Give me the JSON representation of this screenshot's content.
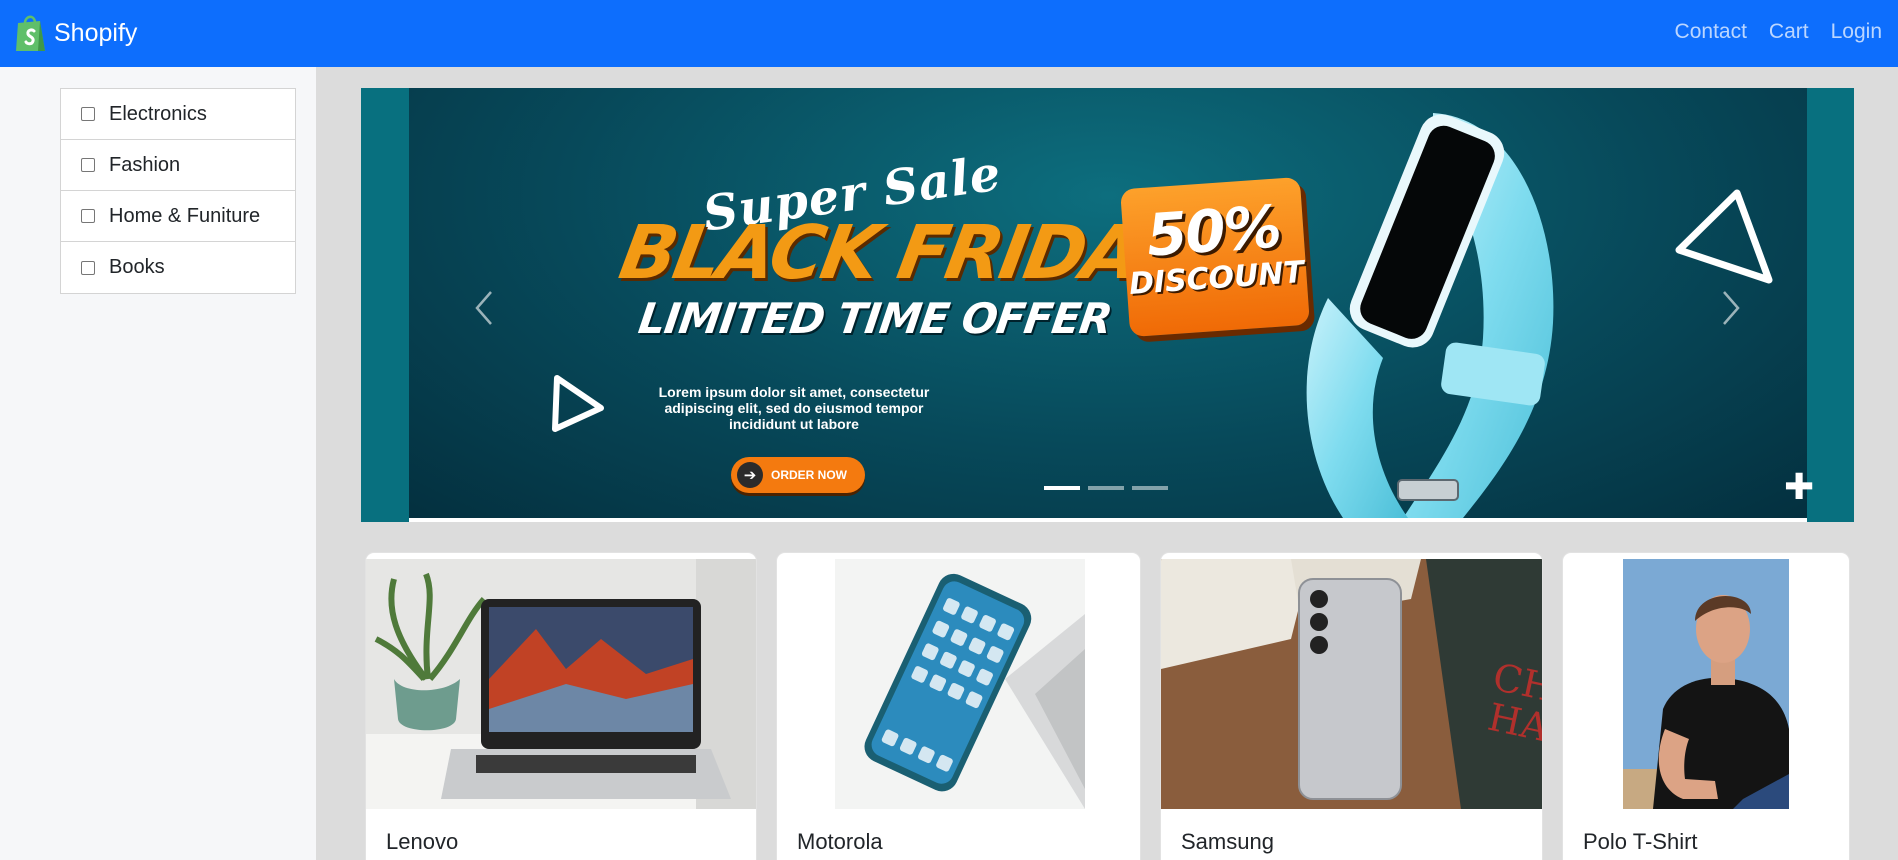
{
  "navbar": {
    "brand": "Shopify",
    "links": [
      "Contact",
      "Cart",
      "Login"
    ],
    "background_color": "#0d6efd",
    "logo_icon": "shopify-bag-icon",
    "logo_color": "#5fbf6a"
  },
  "sidebar": {
    "categories": [
      {
        "label": "Electronics",
        "checked": false
      },
      {
        "label": "Fashion",
        "checked": false
      },
      {
        "label": "Home & Funiture",
        "checked": false
      },
      {
        "label": "Books",
        "checked": false
      }
    ]
  },
  "carousel": {
    "slide_count": 3,
    "active_index": 0,
    "prev_icon": "chevron-left-icon",
    "next_icon": "chevron-right-icon",
    "banner": {
      "script_heading": "Super Sale",
      "heading": "BLACK FRIDAY",
      "subheading": "LIMITED TIME OFFER",
      "description": "Lorem ipsum dolor sit amet, consectetur adipiscing elit, sed do eiusmod tempor incididunt ut labore",
      "cta_label": "ORDER NOW",
      "discount_percent": "50%",
      "discount_label": "DISCOUNT",
      "accent_color": "#f39a14",
      "product_image": "fitness-band-image"
    }
  },
  "products": [
    {
      "name": "Lenovo",
      "image": "laptop-photo"
    },
    {
      "name": "Motorola",
      "image": "smartphone-photo"
    },
    {
      "name": "Samsung",
      "image": "samsung-phone-photo"
    },
    {
      "name": "Polo T-Shirt",
      "image": "man-in-polo-photo"
    }
  ]
}
